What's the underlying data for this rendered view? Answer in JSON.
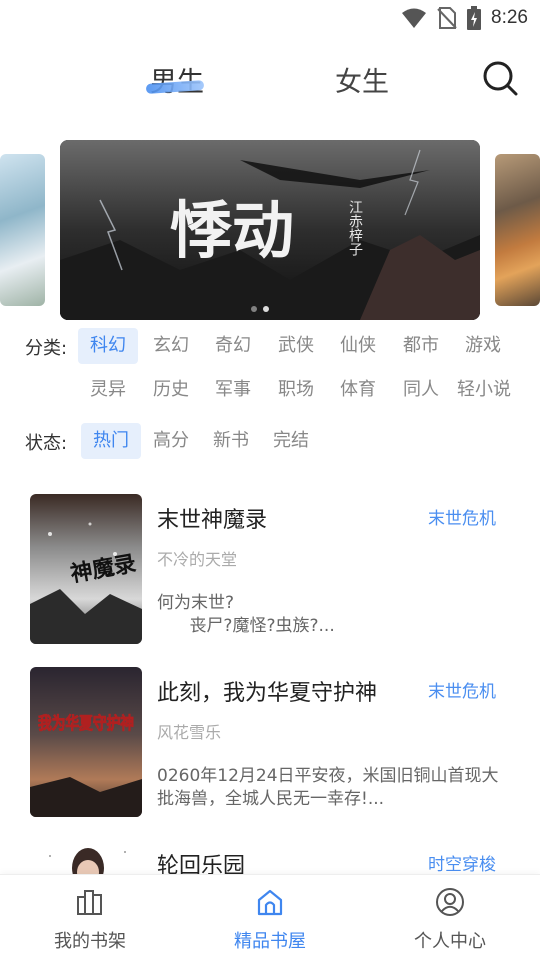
{
  "status_bar": {
    "time": "8:26",
    "icons": [
      "wifi-icon",
      "no-sim-icon",
      "battery-charging-icon"
    ]
  },
  "top_tabs": {
    "tabs": [
      {
        "label": "男生",
        "selected": true
      },
      {
        "label": "女生",
        "selected": false
      }
    ],
    "search_icon": "search-icon",
    "accent": "#4a8ff0"
  },
  "banner": {
    "title_art": "悸动",
    "author_art": "江赤梓子",
    "page_count": 2,
    "active_index": 1
  },
  "category_filter": {
    "label": "分类:",
    "options": [
      "科幻",
      "玄幻",
      "奇幻",
      "武侠",
      "仙侠",
      "都市",
      "游戏",
      "灵异",
      "历史",
      "军事",
      "职场",
      "体育",
      "同人",
      "轻小说"
    ],
    "selected": "科幻"
  },
  "status_filter": {
    "label": "状态:",
    "options": [
      "热门",
      "高分",
      "新书",
      "完结"
    ],
    "selected": "热门"
  },
  "books": [
    {
      "title": "末世神魔录",
      "tag": "末世危机",
      "author": "不冷的天堂",
      "description": "何为末世?\n      丧尸?魔怪?虫族?...",
      "cover_text": "神魔录"
    },
    {
      "title": "此刻，我为华夏守护神",
      "tag": "末世危机",
      "author": "风花雪乐",
      "description": "0260年12月24日平安夜，米国旧铜山首现大批海兽，全城人民无一幸存!...",
      "cover_text": "我为华夏守护神"
    },
    {
      "title": "轮回乐园",
      "tag": "时空穿梭"
    }
  ],
  "bottom_nav": {
    "items": [
      {
        "label": "我的书架",
        "icon": "bookshelf-icon",
        "active": false
      },
      {
        "label": "精品书屋",
        "icon": "house-icon",
        "active": true
      },
      {
        "label": "个人中心",
        "icon": "user-circle-icon",
        "active": false
      }
    ],
    "active_color": "#3f86ef"
  }
}
